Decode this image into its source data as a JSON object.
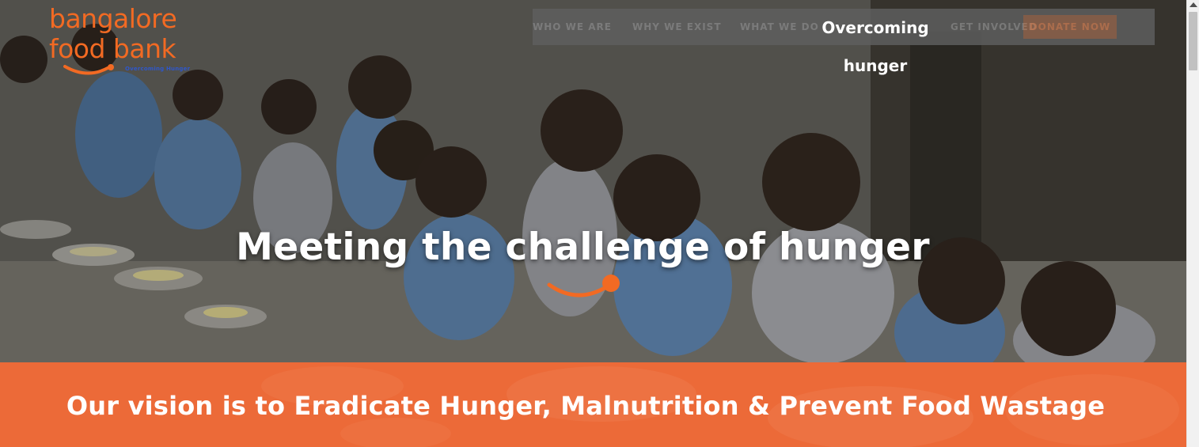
{
  "logo": {
    "line1": "bangalore",
    "line2": "food bank",
    "tagline": "Overcoming Hunger"
  },
  "nav": {
    "items": [
      "WHO WE ARE",
      "WHY WE EXIST",
      "WHAT WE DO",
      "GET INVOLVED"
    ],
    "cta_label": "DONATE NOW",
    "tooltip": "Overcoming hunger"
  },
  "hero": {
    "headline": "Meeting the challenge of hunger"
  },
  "vision": {
    "text": "Our vision is to Eradicate Hunger, Malnutrition & Prevent Food Wastage"
  },
  "colors": {
    "brand_orange": "#f26a23",
    "vision_band": "#ec6a38",
    "tagline_blue": "#2f57c9"
  },
  "icons": {
    "logo_mark": "smile-swoosh-icon",
    "headline_mark": "swoosh-icon"
  }
}
